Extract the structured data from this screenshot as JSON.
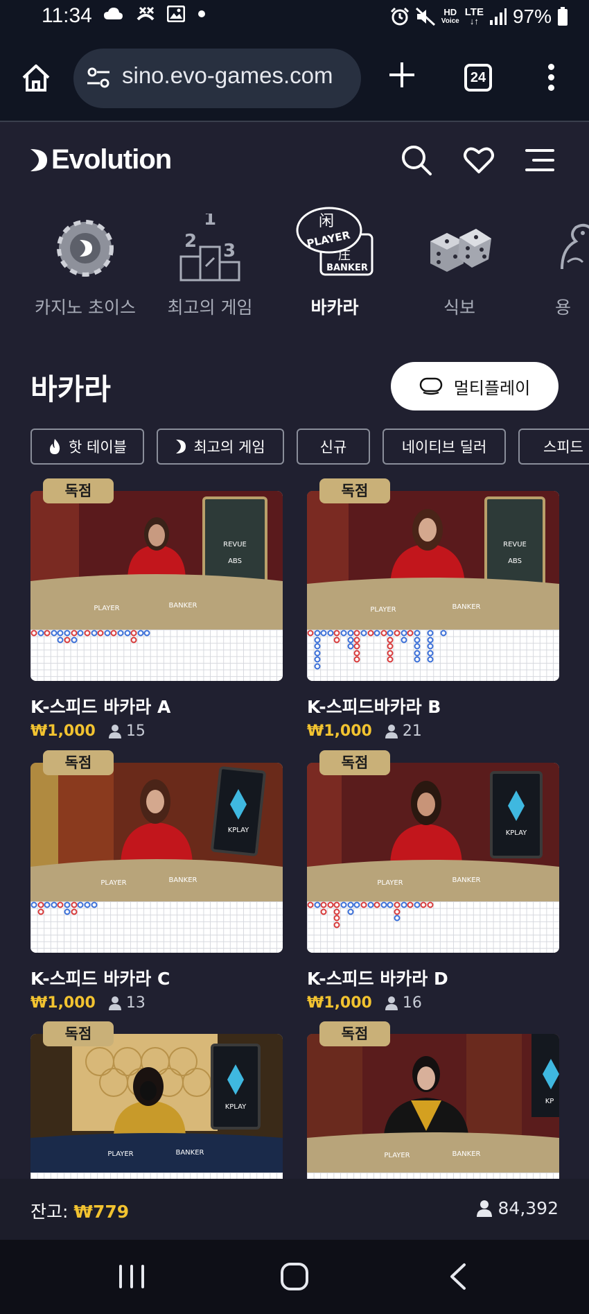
{
  "status_bar": {
    "time": "11:34",
    "battery": "97%",
    "network": "LTE",
    "hd_voice_line1": "HD",
    "hd_voice_line2": "Voice",
    "left_icons": [
      "cloud-icon",
      "call-blocked-icon",
      "image-icon",
      "dot-icon"
    ],
    "right_icons": [
      "alarm-icon",
      "mute-icon",
      "hd-voice-icon",
      "lte-icon",
      "signal-icon",
      "battery-icon"
    ]
  },
  "browser": {
    "url": "sino.evo-games.com",
    "tab_count": "24"
  },
  "site": {
    "logo_text": "Evolution",
    "header_icons": [
      "search-icon",
      "heart-icon",
      "menu-icon"
    ]
  },
  "categories": [
    {
      "label": "카지노 초이스",
      "icon": "casino-chip-icon",
      "active": false
    },
    {
      "label": "최고의 게임",
      "icon": "podium-icon",
      "active": false,
      "podium": [
        "1",
        "2",
        "3"
      ]
    },
    {
      "label": "바카라",
      "icon": "baccarat-icon",
      "active": true,
      "art_text": [
        "闲",
        "PLAYER",
        "庄",
        "BANKER"
      ]
    },
    {
      "label": "식보",
      "icon": "dice-icon",
      "active": false
    },
    {
      "label": "용",
      "icon": "dragon-icon",
      "active": false
    }
  ],
  "section": {
    "title": "바카라",
    "multiplay_label": "멀티플레이"
  },
  "filters": [
    {
      "label": "핫 테이블",
      "icon": "flame-icon"
    },
    {
      "label": "최고의 게임",
      "icon": "evolution-icon"
    },
    {
      "label": "신규",
      "icon": ""
    },
    {
      "label": "네이티브 딜러",
      "icon": ""
    },
    {
      "label": "스피드",
      "icon": ""
    }
  ],
  "games": [
    {
      "badge": "독점",
      "title": "K-스피드 바카라 A",
      "price": "₩1,000",
      "players": "15",
      "table_text": [
        "PLAYER",
        "BANKER"
      ],
      "screen_text": [
        "REVUE",
        "ABS"
      ]
    },
    {
      "badge": "독점",
      "title": "K-스피드바카라 B",
      "price": "₩1,000",
      "players": "21",
      "table_text": [
        "PLAYER",
        "BANKER"
      ],
      "screen_text": [
        "REVUE",
        "ABS"
      ]
    },
    {
      "badge": "독점",
      "title": "K-스피드 바카라 C",
      "price": "₩1,000",
      "players": "13",
      "table_text": [
        "PLAYER",
        "BANKER"
      ],
      "screen_text": [
        "KPLAY"
      ]
    },
    {
      "badge": "독점",
      "title": "K-스피드 바카라 D",
      "price": "₩1,000",
      "players": "16",
      "table_text": [
        "PLAYER",
        "BANKER"
      ],
      "screen_text": [
        "KPLAY"
      ]
    },
    {
      "badge": "독점",
      "title": "",
      "price": "",
      "players": "",
      "table_text": [
        "PLAYER",
        "BANKER"
      ],
      "screen_text": [
        "KPLAY"
      ]
    },
    {
      "badge": "독점",
      "title": "",
      "price": "",
      "players": "",
      "table_text": [
        "PLAYER",
        "BANKER"
      ],
      "screen_text": [
        "KP"
      ]
    }
  ],
  "footer": {
    "balance_label": "잔고:",
    "balance_value": "₩779",
    "online_count": "84,392"
  },
  "colors": {
    "background": "#202030",
    "accent_gold": "#f2c330",
    "badge_gold": "#c9b078",
    "player_blue": "#3a6fd8",
    "banker_red": "#d83a3a"
  }
}
